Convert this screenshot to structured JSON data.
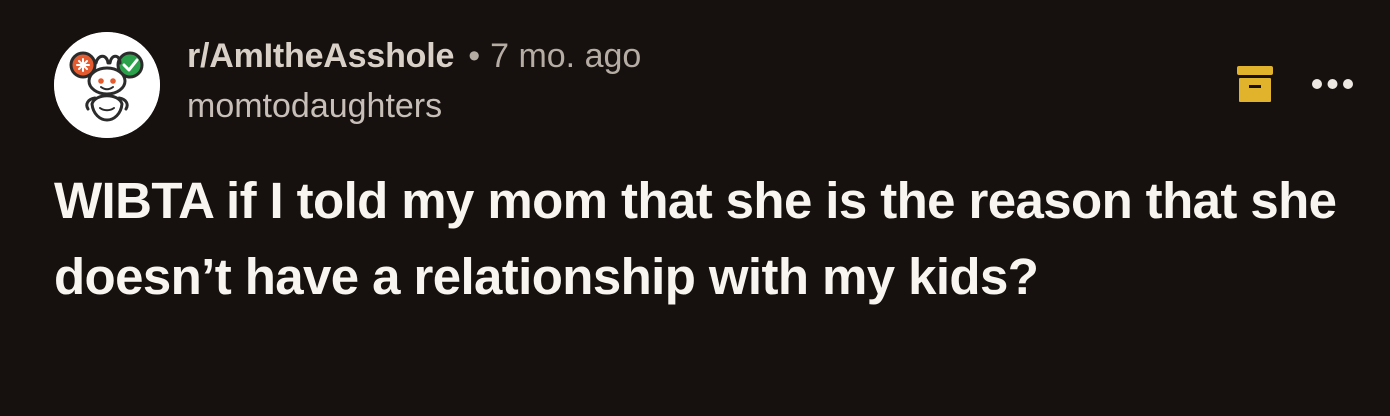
{
  "post": {
    "subreddit": "r/AmItheAsshole",
    "separator": "•",
    "age": "7 mo. ago",
    "author": "momtodaughters",
    "title": "WIBTA if I told my mom that she is the reason that she doesn’t have a relationship with my kids?"
  },
  "actions": {
    "archive_icon": "archive-box-icon",
    "more_icon": "more-horizontal-icon"
  },
  "colors": {
    "background": "#16110f",
    "archive_icon": "#e1b22c",
    "avatar_badge_orange": "#e45b2f",
    "avatar_badge_green": "#2aa14a"
  }
}
